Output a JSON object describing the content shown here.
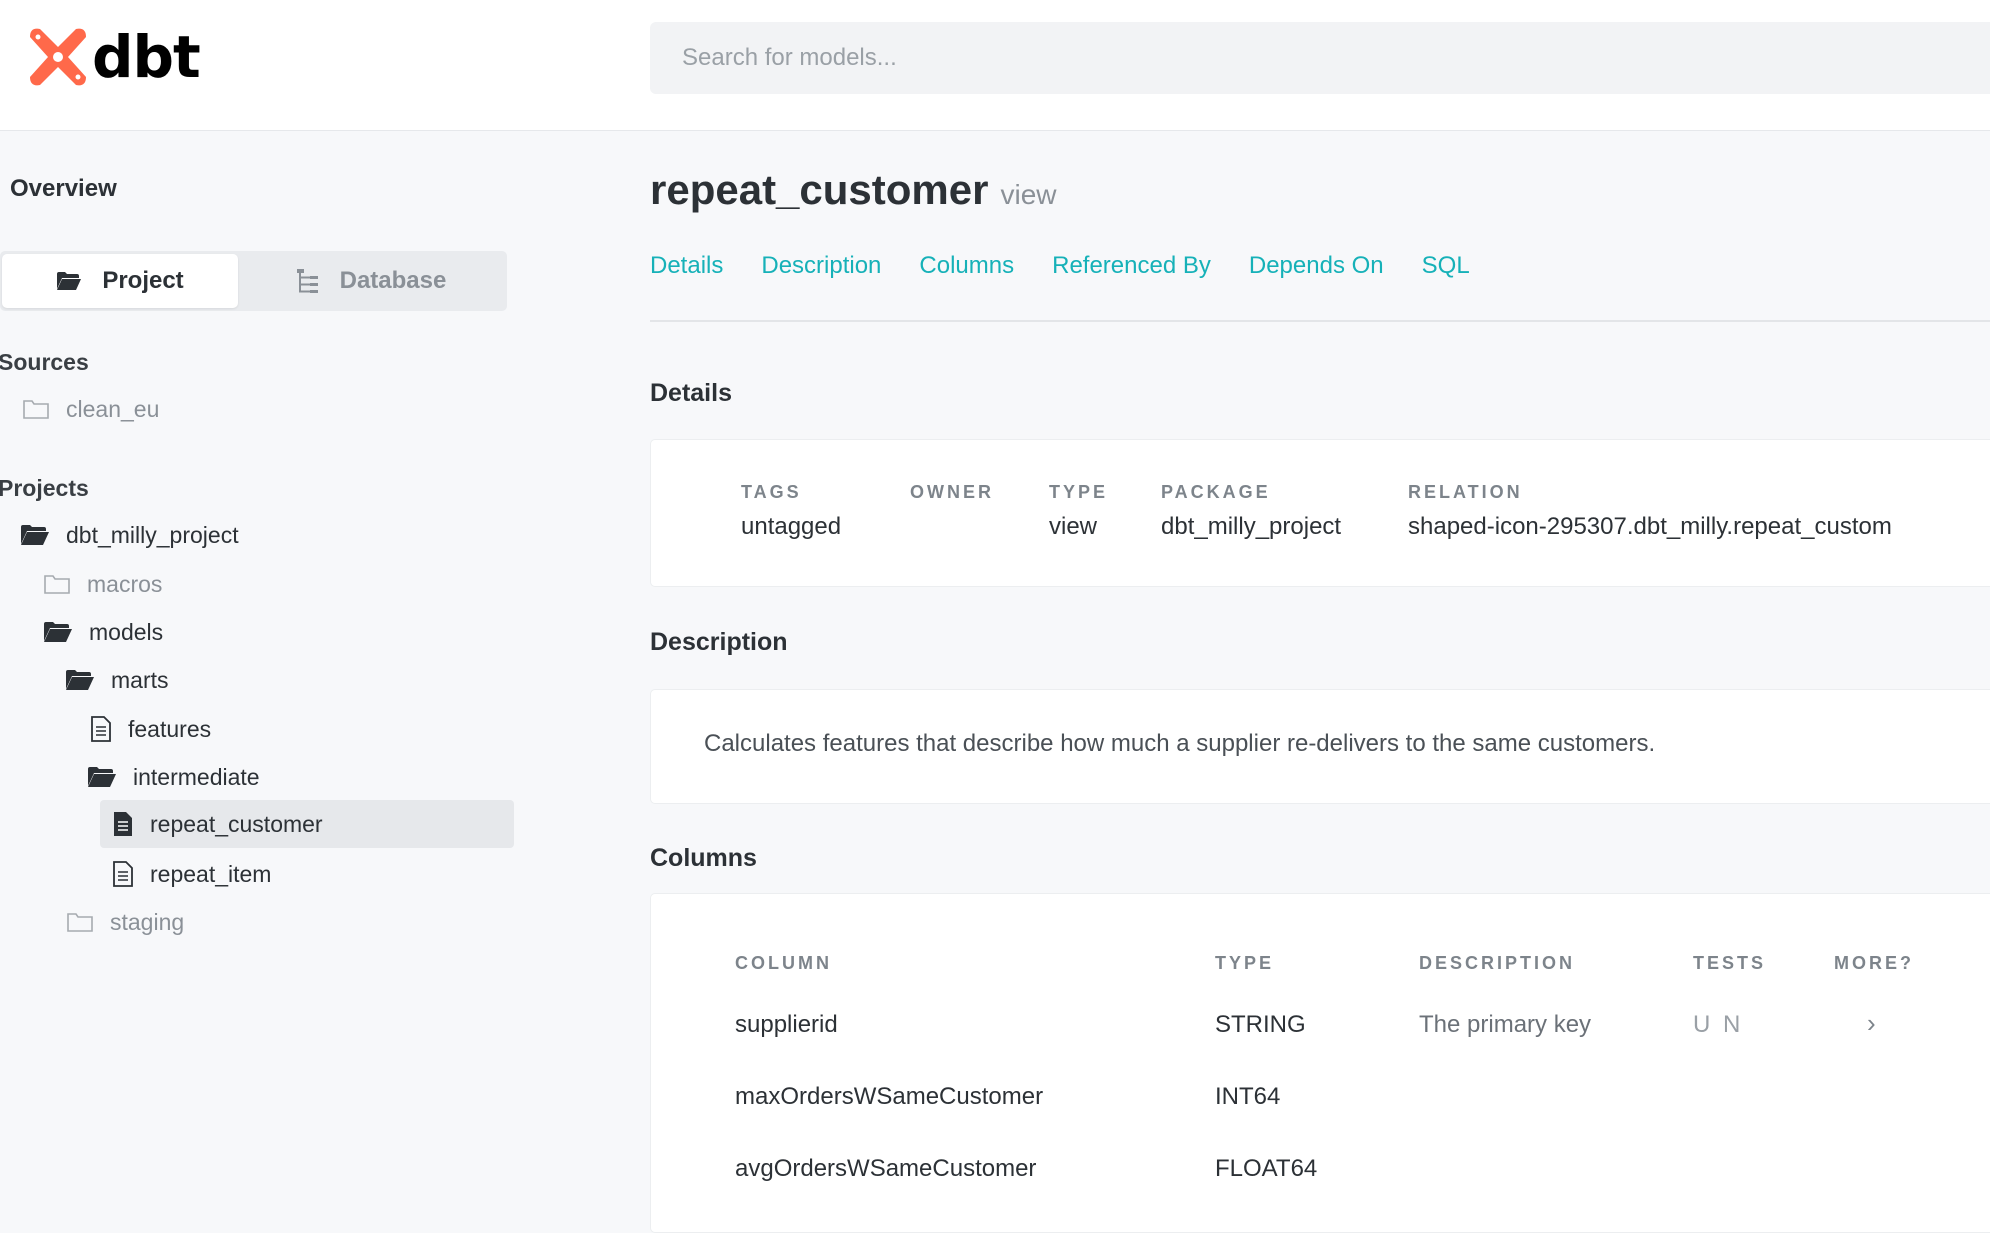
{
  "header": {
    "logo_text": "dbt",
    "search_placeholder": "Search for models..."
  },
  "sidebar": {
    "overview_label": "Overview",
    "toggle": {
      "project_label": "Project",
      "database_label": "Database"
    },
    "sources_heading": "Sources",
    "sources": [
      {
        "label": "clean_eu"
      }
    ],
    "projects_heading": "Projects",
    "tree": [
      {
        "label": "dbt_milly_project"
      },
      {
        "label": "macros"
      },
      {
        "label": "models"
      },
      {
        "label": "marts"
      },
      {
        "label": "features"
      },
      {
        "label": "intermediate"
      },
      {
        "label": "repeat_customer"
      },
      {
        "label": "repeat_item"
      },
      {
        "label": "staging"
      }
    ]
  },
  "model": {
    "name": "repeat_customer",
    "materialization": "view"
  },
  "tabs": [
    "Details",
    "Description",
    "Columns",
    "Referenced By",
    "Depends On",
    "SQL"
  ],
  "details": {
    "heading": "Details",
    "fields": [
      {
        "label": "TAGS",
        "value": "untagged"
      },
      {
        "label": "OWNER",
        "value": ""
      },
      {
        "label": "TYPE",
        "value": "view"
      },
      {
        "label": "PACKAGE",
        "value": "dbt_milly_project"
      },
      {
        "label": "RELATION",
        "value": "shaped-icon-295307.dbt_milly.repeat_custom"
      }
    ]
  },
  "description": {
    "heading": "Description",
    "text": "Calculates features that describe how much a supplier re-delivers to the same customers."
  },
  "columns": {
    "heading": "Columns",
    "headers": [
      "COLUMN",
      "TYPE",
      "DESCRIPTION",
      "TESTS",
      "MORE?"
    ],
    "rows": [
      {
        "column": "supplierid",
        "type": "STRING",
        "description": "The primary key",
        "tests": "U N",
        "more": "›"
      },
      {
        "column": "maxOrdersWSameCustomer",
        "type": "INT64",
        "description": "",
        "tests": "",
        "more": ""
      },
      {
        "column": "avgOrdersWSameCustomer",
        "type": "FLOAT64",
        "description": "",
        "tests": "",
        "more": ""
      }
    ]
  },
  "colors": {
    "accent": "#16b1b8",
    "logo": "#ff694a"
  }
}
